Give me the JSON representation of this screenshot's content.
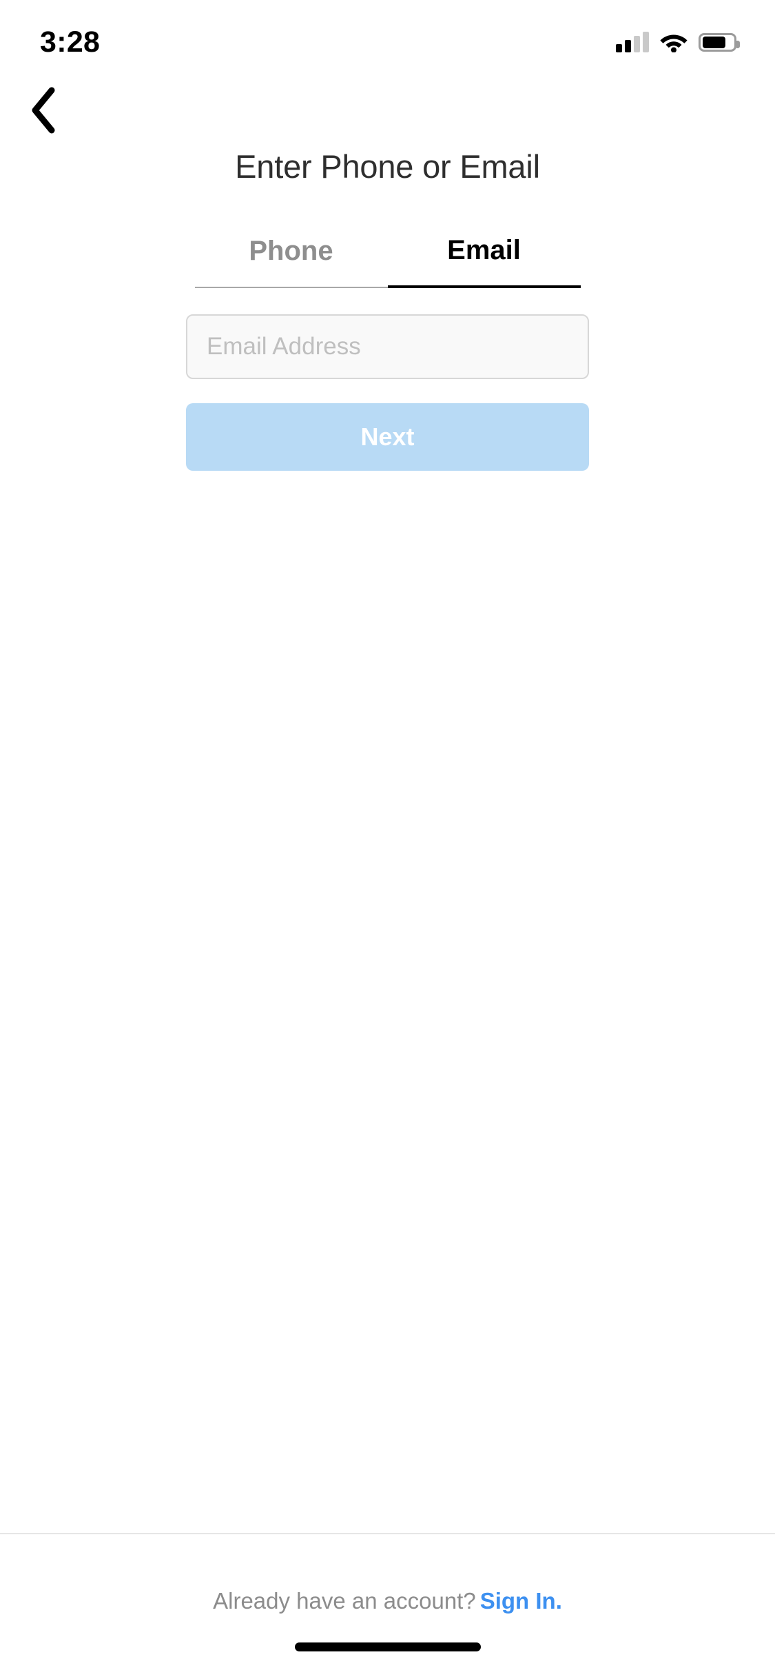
{
  "status_bar": {
    "time": "3:28",
    "signal_icon": "cellular-signal-icon",
    "signal_bars_total": 4,
    "signal_bars_filled": 2,
    "wifi_icon": "wifi-icon",
    "battery_icon": "battery-icon",
    "battery_percent": 68
  },
  "nav": {
    "back_icon": "chevron-left-icon"
  },
  "header": {
    "title": "Enter Phone or Email"
  },
  "tabs": [
    {
      "label": "Phone",
      "active": false
    },
    {
      "label": "Email",
      "active": true
    }
  ],
  "form": {
    "email_placeholder": "Email Address",
    "email_value": "",
    "next_label": "Next"
  },
  "footer": {
    "prompt": "Already have an account?",
    "link_label": "Sign In."
  },
  "colors": {
    "title": "#2e2e2e",
    "tab_active": "#000000",
    "tab_inactive": "#8e8e8e",
    "input_bg": "#f9f9f9",
    "input_border": "#d7d7d7",
    "placeholder": "#bfbfbf",
    "next_button_bg": "#b8daf5",
    "next_button_text": "#ffffff",
    "footer_text": "#8c8c8c",
    "footer_link": "#3d90f0",
    "divider": "#e6e6e6"
  }
}
